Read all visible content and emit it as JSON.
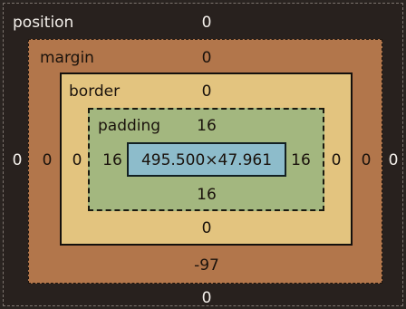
{
  "position": {
    "label": "position",
    "top": "0",
    "right": "0",
    "bottom": "0",
    "left": "0"
  },
  "margin": {
    "label": "margin",
    "top": "0",
    "right": "0",
    "bottom": "-97",
    "left": "0"
  },
  "border": {
    "label": "border",
    "top": "0",
    "right": "0",
    "bottom": "0",
    "left": "0"
  },
  "padding": {
    "label": "padding",
    "top": "16",
    "right": "16",
    "bottom": "16",
    "left": "16"
  },
  "content": {
    "size": "495.500×47.961"
  },
  "colors": {
    "position": "#28211e",
    "margin": "#b2764b",
    "border": "#e3c47f",
    "padding": "#a3b77f",
    "content": "#8dbccb"
  }
}
